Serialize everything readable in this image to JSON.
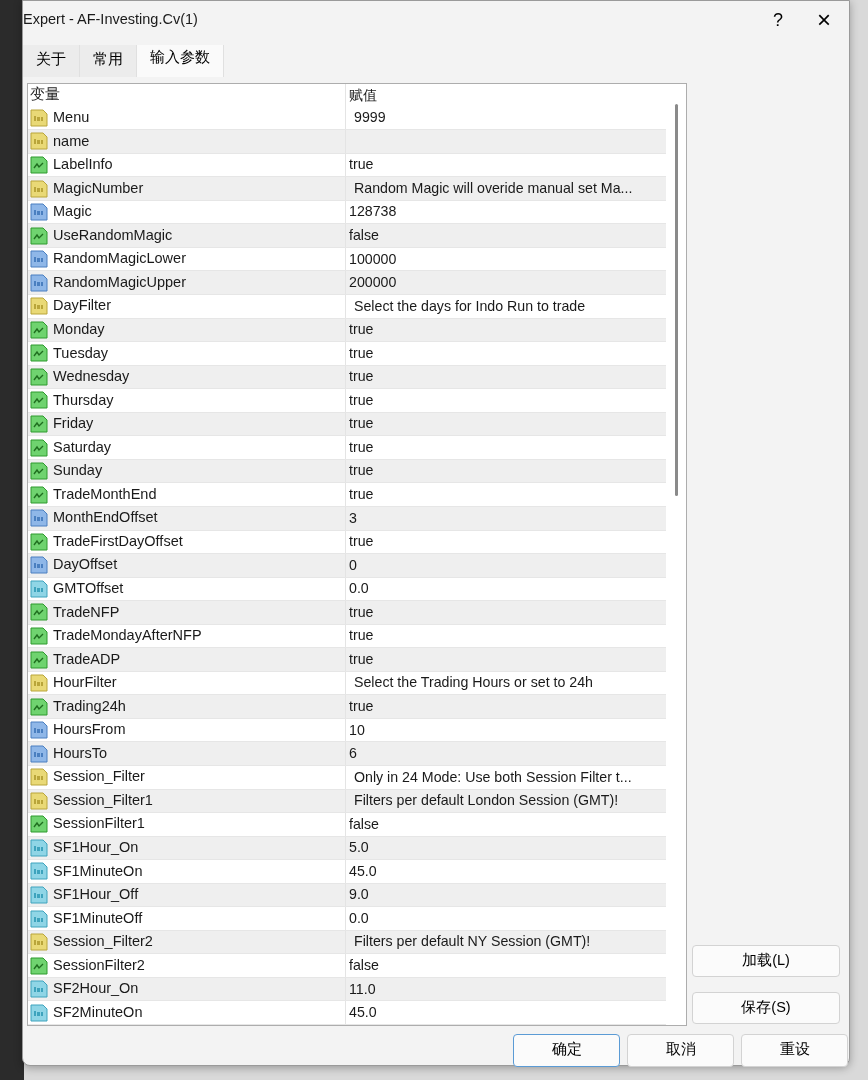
{
  "window": {
    "title": "Expert - AF-Investing.Cv(1)",
    "help": "?",
    "close": "×"
  },
  "tabs": [
    {
      "label": "关于",
      "selected": false
    },
    {
      "label": "常用",
      "selected": false
    },
    {
      "label": "输入参数",
      "selected": true
    }
  ],
  "table": {
    "columns": [
      "变量",
      "赋值"
    ],
    "rows": [
      {
        "kind": "string",
        "name": "Menu",
        "value": "9999"
      },
      {
        "kind": "string",
        "name": "name",
        "value": ""
      },
      {
        "kind": "bool",
        "name": "LabelInfo",
        "value": "true"
      },
      {
        "kind": "string",
        "name": "MagicNumber",
        "value": "Random Magic will overide manual set Ma..."
      },
      {
        "kind": "int",
        "name": "Magic",
        "value": "128738"
      },
      {
        "kind": "bool",
        "name": "UseRandomMagic",
        "value": "false"
      },
      {
        "kind": "int",
        "name": "RandomMagicLower",
        "value": "100000"
      },
      {
        "kind": "int",
        "name": "RandomMagicUpper",
        "value": "200000"
      },
      {
        "kind": "string",
        "name": "DayFilter",
        "value": "Select the days for Indo Run to trade"
      },
      {
        "kind": "bool",
        "name": "Monday",
        "value": "true"
      },
      {
        "kind": "bool",
        "name": "Tuesday",
        "value": "true"
      },
      {
        "kind": "bool",
        "name": "Wednesday",
        "value": "true"
      },
      {
        "kind": "bool",
        "name": "Thursday",
        "value": "true"
      },
      {
        "kind": "bool",
        "name": "Friday",
        "value": "true"
      },
      {
        "kind": "bool",
        "name": "Saturday",
        "value": "true"
      },
      {
        "kind": "bool",
        "name": "Sunday",
        "value": "true"
      },
      {
        "kind": "bool",
        "name": "TradeMonthEnd",
        "value": "true"
      },
      {
        "kind": "int",
        "name": "MonthEndOffset",
        "value": "3"
      },
      {
        "kind": "bool",
        "name": "TradeFirstDayOffset",
        "value": "true"
      },
      {
        "kind": "int",
        "name": "DayOffset",
        "value": "0"
      },
      {
        "kind": "double",
        "name": "GMTOffset",
        "value": "0.0"
      },
      {
        "kind": "bool",
        "name": "TradeNFP",
        "value": "true"
      },
      {
        "kind": "bool",
        "name": "TradeMondayAfterNFP",
        "value": "true"
      },
      {
        "kind": "bool",
        "name": "TradeADP",
        "value": "true"
      },
      {
        "kind": "string",
        "name": "HourFilter",
        "value": "Select the Trading Hours or set to 24h"
      },
      {
        "kind": "bool",
        "name": "Trading24h",
        "value": "true"
      },
      {
        "kind": "int",
        "name": "HoursFrom",
        "value": "10"
      },
      {
        "kind": "int",
        "name": "HoursTo",
        "value": "6"
      },
      {
        "kind": "string",
        "name": "Session_Filter",
        "value": "Only in 24 Mode: Use both Session Filter t..."
      },
      {
        "kind": "string",
        "name": "Session_Filter1",
        "value": "Filters per default London Session (GMT)!"
      },
      {
        "kind": "bool",
        "name": "SessionFilter1",
        "value": "false"
      },
      {
        "kind": "double",
        "name": "SF1Hour_On",
        "value": "5.0"
      },
      {
        "kind": "double",
        "name": "SF1MinuteOn",
        "value": "45.0"
      },
      {
        "kind": "double",
        "name": "SF1Hour_Off",
        "value": "9.0"
      },
      {
        "kind": "double",
        "name": "SF1MinuteOff",
        "value": "0.0"
      },
      {
        "kind": "string",
        "name": "Session_Filter2",
        "value": "Filters per default NY Session (GMT)!"
      },
      {
        "kind": "bool",
        "name": "SessionFilter2",
        "value": "false"
      },
      {
        "kind": "double",
        "name": "SF2Hour_On",
        "value": "11.0"
      },
      {
        "kind": "double",
        "name": "SF2MinuteOn",
        "value": "45.0"
      }
    ]
  },
  "side_buttons": [
    "加载(L)",
    "保存(S)"
  ],
  "buttons": [
    {
      "label": "确定",
      "default": true
    },
    {
      "label": "取消",
      "default": false
    },
    {
      "label": "重设",
      "default": false
    }
  ]
}
